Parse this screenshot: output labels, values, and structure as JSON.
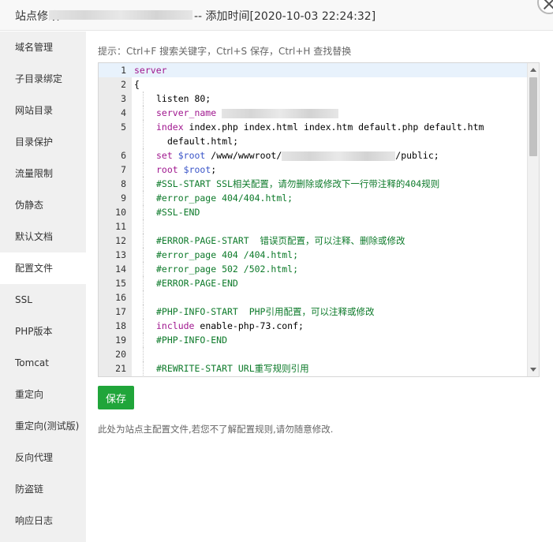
{
  "title": {
    "prefix": "站点修改",
    "suffix": "-- 添加时间[2020-10-03 22:24:32]"
  },
  "sidebar": {
    "items": [
      {
        "label": "域名管理"
      },
      {
        "label": "子目录绑定"
      },
      {
        "label": "网站目录"
      },
      {
        "label": "目录保护"
      },
      {
        "label": "流量限制"
      },
      {
        "label": "伪静态"
      },
      {
        "label": "默认文档"
      },
      {
        "label": "配置文件",
        "active": true
      },
      {
        "label": "SSL"
      },
      {
        "label": "PHP版本"
      },
      {
        "label": "Tomcat"
      },
      {
        "label": "重定向"
      },
      {
        "label": "重定向(测试版)"
      },
      {
        "label": "反向代理"
      },
      {
        "label": "防盗链"
      },
      {
        "label": "响应日志"
      }
    ]
  },
  "hint": "提示：Ctrl+F 搜索关键字，Ctrl+S 保存，Ctrl+H 查找替换",
  "editor": {
    "line_numbers": [
      "1",
      "2",
      "3",
      "4",
      "5",
      "6",
      "7",
      "8",
      "9",
      "10",
      "11",
      "12",
      "13",
      "14",
      "15",
      "16",
      "17",
      "18",
      "19",
      "20",
      "21"
    ],
    "lines": {
      "l1": "server",
      "l2": "{",
      "l3": "listen 80;",
      "l4_kw": "server_name",
      "l5_kw": "index",
      "l5_rest": " index.php index.html index.htm default.php default.htm",
      "l5_cont": "default.html;",
      "l6_kw": "set",
      "l6_var": "$root",
      "l6_a": " /www/wwwroot/",
      "l6_b": "/public;",
      "l7_kw": "root",
      "l7_var": "$root",
      "l7_end": ";",
      "l8": "#SSL-START SSL相关配置，请勿删除或修改下一行带注释的404规则",
      "l9": "#error_page 404/404.html;",
      "l10": "#SSL-END",
      "l12": "#ERROR-PAGE-START  错误页配置，可以注释、删除或修改",
      "l13": "#error_page 404 /404.html;",
      "l14": "#error_page 502 /502.html;",
      "l15": "#ERROR-PAGE-END",
      "l17": "#PHP-INFO-START  PHP引用配置，可以注释或修改",
      "l18_kw": "include",
      "l18_rest": " enable-php-73.conf;",
      "l19": "#PHP-INFO-END",
      "l21": "#REWRITE-START URL重写规则引用"
    }
  },
  "save_button": "保存",
  "note": "此处为站点主配置文件,若您不了解配置规则,请勿随意修改.",
  "colors": {
    "accent": "#20a53a",
    "keyword": "#a0178f",
    "variable": "#3a55c9",
    "comment": "#0d7a2a"
  }
}
